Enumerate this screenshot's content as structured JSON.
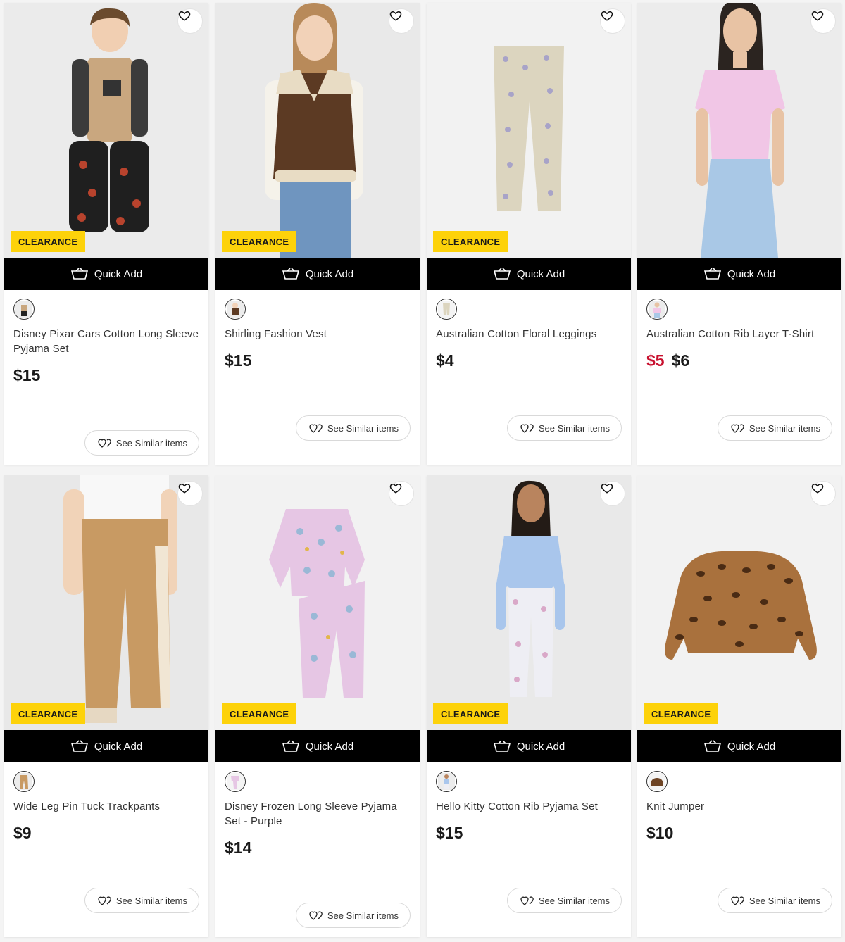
{
  "colors": {
    "badge_bg": "#fdd20a",
    "sale_price": "#c8102e",
    "quick_add_bg": "#000000"
  },
  "products": [
    {
      "name": "Disney Pixar Cars Cotton Long Sleeve Pyjama Set",
      "badge": "CLEARANCE",
      "quick_add": "Quick Add",
      "price": "$15",
      "sale_price": "",
      "similar": "See Similar items",
      "image": "boy-pyjama"
    },
    {
      "name": "Shirling Fashion Vest",
      "badge": "CLEARANCE",
      "quick_add": "Quick Add",
      "price": "$15",
      "sale_price": "",
      "similar": "See Similar items",
      "image": "girl-vest"
    },
    {
      "name": "Australian Cotton Floral Leggings",
      "badge": "CLEARANCE",
      "quick_add": "Quick Add",
      "price": "$4",
      "sale_price": "",
      "similar": "See Similar items",
      "image": "leggings"
    },
    {
      "name": "Australian Cotton Rib Layer T-Shirt",
      "badge": "",
      "quick_add": "Quick Add",
      "price": "$6",
      "sale_price": "$5",
      "similar": "See Similar items",
      "image": "woman-tshirt"
    },
    {
      "name": "Wide Leg Pin Tuck Trackpants",
      "badge": "CLEARANCE",
      "quick_add": "Quick Add",
      "price": "$9",
      "sale_price": "",
      "similar": "See Similar items",
      "image": "trackpants"
    },
    {
      "name": "Disney Frozen Long Sleeve Pyjama Set - Purple",
      "badge": "CLEARANCE",
      "quick_add": "Quick Add",
      "price": "$14",
      "sale_price": "",
      "similar": "See Similar items",
      "image": "frozen-pyjama"
    },
    {
      "name": "Hello Kitty Cotton Rib Pyjama Set",
      "badge": "CLEARANCE",
      "quick_add": "Quick Add",
      "price": "$15",
      "sale_price": "",
      "similar": "See Similar items",
      "image": "girl-pyjama"
    },
    {
      "name": "Knit Jumper",
      "badge": "CLEARANCE",
      "quick_add": "Quick Add",
      "price": "$10",
      "sale_price": "",
      "similar": "See Similar items",
      "image": "jumper"
    }
  ]
}
